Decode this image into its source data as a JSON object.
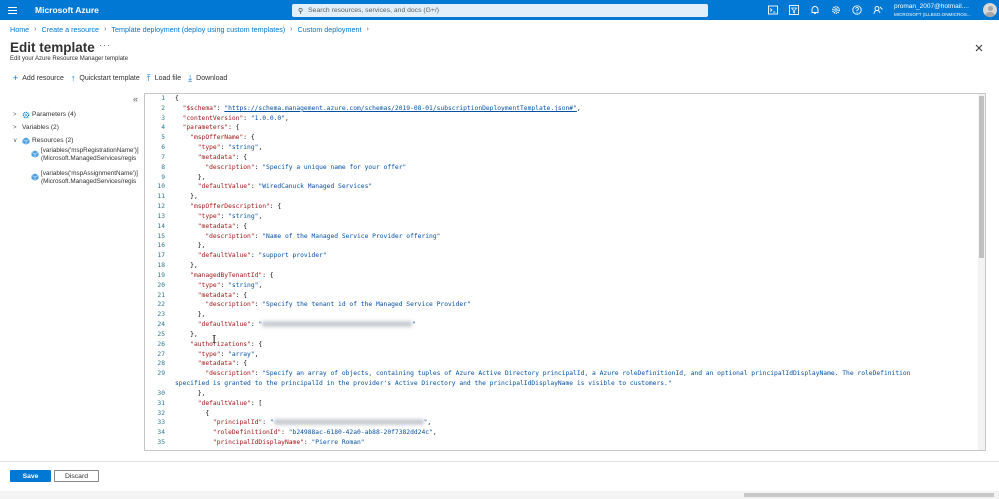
{
  "topbar": {
    "brand": "Microsoft Azure",
    "search_placeholder": "Search resources, services, and docs (G+/)",
    "account_email": "proman_2007@hotmail....",
    "account_tenant": "MICROSOFT (ILLBSO.ONMICROS...",
    "icons": [
      "cloud-shell-icon",
      "directory-filter-icon",
      "notifications-icon",
      "settings-icon",
      "help-icon",
      "feedback-icon"
    ]
  },
  "breadcrumb": [
    "Home",
    "Create a resource",
    "Template deployment (deploy using custom templates)",
    "Custom deployment"
  ],
  "header": {
    "title": "Edit template",
    "more": "···",
    "subtitle": "Edit your Azure Resource Manager template"
  },
  "toolbar": {
    "add_resource": "Add resource",
    "quickstart_template": "Quickstart template",
    "load_file": "Load file",
    "download": "Download"
  },
  "tree": {
    "parameters": "Parameters (4)",
    "variables": "Variables (2)",
    "resources": "Resources (2)",
    "res1_line1": "[variables('mspRegistrationName')]",
    "res1_line2": "(Microsoft.ManagedServices/regis",
    "res2_line1": "[variables('mspAssignmentName')]",
    "res2_line2": "(Microsoft.ManagedServices/regis"
  },
  "code": {
    "l1": "{",
    "l2_key": "\"$schema\"",
    "l2_val": "\"https://schema.management.azure.com/schemas/2019-08-01/subscriptionDeploymentTemplate.json#\"",
    "l3_key": "\"contentVersion\"",
    "l3_val": "\"1.0.0.0\"",
    "l4_key": "\"parameters\"",
    "l5_key": "\"mspOfferName\"",
    "l6_key": "\"type\"",
    "l6_val": "\"string\"",
    "l7_key": "\"metadata\"",
    "l8_key": "\"description\"",
    "l8_val": "\"Specify a unique name for your offer\"",
    "l10_key": "\"defaultValue\"",
    "l10_val": "\"WiredCanuck Managed Services\"",
    "l12_key": "\"mspOfferDescription\"",
    "l13_key": "\"type\"",
    "l13_val": "\"string\"",
    "l14_key": "\"metadata\"",
    "l15_key": "\"description\"",
    "l15_val": "\"Name of the Managed Service Provider offering\"",
    "l17_key": "\"defaultValue\"",
    "l17_val": "\"support provider\"",
    "l19_key": "\"managedByTenantId\"",
    "l20_key": "\"type\"",
    "l20_val": "\"string\"",
    "l21_key": "\"metadata\"",
    "l22_key": "\"description\"",
    "l22_val": "\"Specify the tenant id of the Managed Service Provider\"",
    "l24_key": "\"defaultValue\"",
    "l26_key": "\"authorizations\"",
    "l27_key": "\"type\"",
    "l27_val": "\"array\"",
    "l28_key": "\"metadata\"",
    "l29_key": "\"description\"",
    "l29_val": "\"Specify an array of objects, containing tuples of Azure Active Directory principalId, a Azure roleDefinitionId, and an optional principalIdDisplayName. The roleDefinition specified is granted to the principalId in the provider's Active Directory and the principalIdDisplayName is visible to customers.\"",
    "l31_key": "\"defaultValue\"",
    "l33_key": "\"principalId\"",
    "l34_key": "\"roleDefinitionId\"",
    "l34_val": "\"b24988ac-6180-42a0-ab88-20f7382dd24c\"",
    "l35_key": "\"principalIdDisplayName\"",
    "l35_val": "\"Pierre Roman\""
  },
  "footer": {
    "save": "Save",
    "discard": "Discard"
  }
}
